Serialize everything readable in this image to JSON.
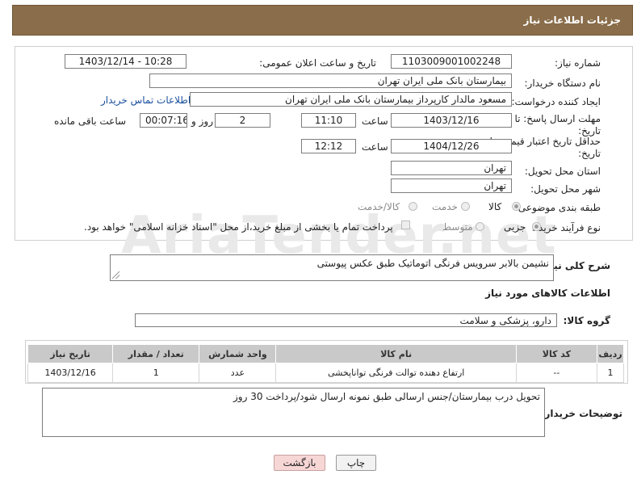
{
  "header": {
    "title": "جزئیات اطلاعات نیاز"
  },
  "watermark": "AriaTender.net",
  "form": {
    "need_number": {
      "label": "شماره نیاز:",
      "value": "1103009001002248"
    },
    "announce_datetime": {
      "label": "تاریخ و ساعت اعلان عمومی:",
      "value": "1403/12/14 - 10:28"
    },
    "buyer_org": {
      "label": "نام دستگاه خریدار:",
      "value": "بیمارستان بانک ملی ایران تهران"
    },
    "requester": {
      "label": "ایجاد کننده درخواست:",
      "value": "مسعود مالدار کارپرداز بیمارستان بانک ملی ایران تهران",
      "contact_link": "اطلاعات تماس خریدار"
    },
    "reply_deadline": {
      "label_line1": "مهلت ارسال پاسخ: تا",
      "label_line2": "تاریخ:",
      "date": "1403/12/16",
      "time_label": "ساعت",
      "time": "11:10",
      "days": "2",
      "days_label": "روز و",
      "remaining": "00:07:16",
      "remaining_label": "ساعت باقی مانده"
    },
    "price_validity": {
      "label_line1": "حداقل تاریخ اعتبار قیمت: تا",
      "label_line2": "تاریخ:",
      "date": "1404/12/26",
      "time_label": "ساعت",
      "time": "12:12"
    },
    "delivery_province": {
      "label": "استان محل تحویل:",
      "value": "تهران"
    },
    "delivery_city": {
      "label": "شهر محل تحویل:",
      "value": "تهران"
    },
    "category": {
      "label": "طبقه بندی موضوعی:",
      "options": [
        "کالا",
        "خدمت",
        "کالا/خدمت"
      ],
      "selected": "کالا"
    },
    "purchase_type": {
      "label": "نوع فرآیند خرید :",
      "options": [
        "جزیی",
        "متوسط"
      ],
      "selected": "جزیی",
      "payment_note": "پرداخت تمام یا بخشی از مبلغ خرید،از محل \"اسناد خزانه اسلامی\" خواهد بود."
    }
  },
  "summary": {
    "label": "شرح کلی نیاز:",
    "value": "نشیمن بالابر سرویس فرنگی اتوماتیک طبق عکس پیوستی"
  },
  "goods_section_title": "اطلاعات کالاهای مورد نیاز",
  "goods_group": {
    "label": "گروه کالا:",
    "value": "دارو، پزشکی و سلامت"
  },
  "table": {
    "headers": [
      "ردیف",
      "کد کالا",
      "نام کالا",
      "واحد شمارش",
      "تعداد / مقدار",
      "تاریخ نیاز"
    ],
    "rows": [
      [
        "1",
        "--",
        "ارتفاع دهنده توالت فرنگی تواناپخشی",
        "عدد",
        "1",
        "1403/12/16"
      ]
    ]
  },
  "buyer_notes": {
    "label": "توضیحات خریدار:",
    "value": "تحویل درب بیمارستان/جنس ارسالی طبق نمونه ارسال شود/پرداخت 30 روز"
  },
  "buttons": {
    "print": "چاپ",
    "back": "بازگشت"
  },
  "colors": {
    "header_bg": "#8a6d4a",
    "table_header_bg": "#c9c9c9",
    "back_button_bg": "#f7d6d6",
    "link": "#1a4f9c"
  }
}
